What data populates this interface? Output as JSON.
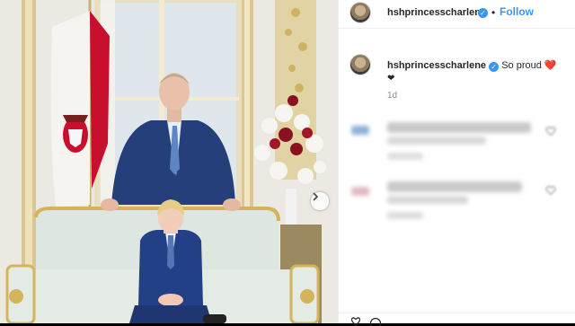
{
  "header": {
    "username": "hshprincesscharlene",
    "follow_label": "Follow",
    "separator": "•"
  },
  "post": {
    "username": "hshprincesscharlene",
    "caption": "So proud ❤️",
    "caption_line2": "❤",
    "age": "1d"
  },
  "comments": [
    {
      "author": "",
      "text": ""
    },
    {
      "author": "",
      "text": ""
    }
  ],
  "colors": {
    "link_blue": "#3897f0",
    "text_dark": "#262626",
    "muted": "#8e8e8e",
    "jacket_navy": "#243f7a",
    "flag_red": "#c8102e"
  },
  "icons": {
    "verified": "verified-badge-icon",
    "carousel_next": "chevron-right-icon",
    "comment_like": "heart-icon"
  }
}
